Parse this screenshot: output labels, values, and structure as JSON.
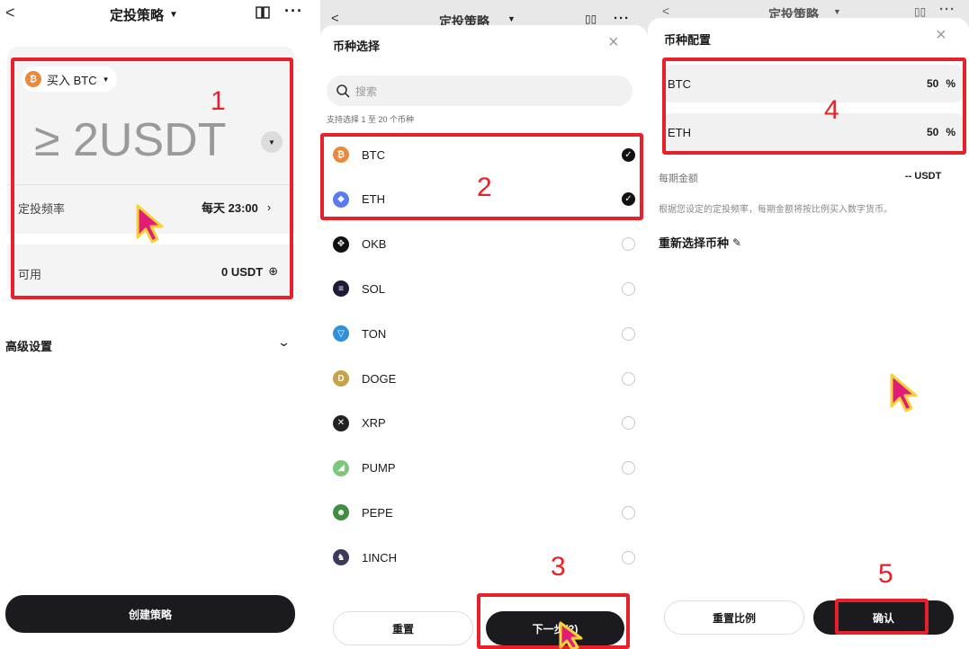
{
  "panel1": {
    "title": "定投策略",
    "buy_label": "买入 BTC",
    "amount": "≥ 2USDT",
    "frequency_label": "定投频率",
    "frequency_value": "每天 23:00",
    "available_label": "可用",
    "available_value": "0 USDT",
    "advanced_label": "高级设置",
    "create_button": "创建策略",
    "annotation": "1"
  },
  "panel2": {
    "title": "定投策略",
    "sheet_title": "币种选择",
    "search_placeholder": "搜索",
    "hint": "支持选择 1 至 20 个币种",
    "coins": [
      {
        "name": "BTC",
        "selected": true,
        "color": "#e8893b",
        "glyph": "₿"
      },
      {
        "name": "ETH",
        "selected": true,
        "color": "#5b7cf0",
        "glyph": "◆"
      },
      {
        "name": "OKB",
        "selected": false,
        "color": "#111111",
        "glyph": "✥"
      },
      {
        "name": "SOL",
        "selected": false,
        "color": "#1e1b3a",
        "glyph": "≡"
      },
      {
        "name": "TON",
        "selected": false,
        "color": "#2f8fd8",
        "glyph": "▽"
      },
      {
        "name": "DOGE",
        "selected": false,
        "color": "#c8a24a",
        "glyph": "D"
      },
      {
        "name": "XRP",
        "selected": false,
        "color": "#222222",
        "glyph": "✕"
      },
      {
        "name": "PUMP",
        "selected": false,
        "color": "#7dc67d",
        "glyph": "◢"
      },
      {
        "name": "PEPE",
        "selected": false,
        "color": "#3f8f3f",
        "glyph": "☻"
      },
      {
        "name": "1INCH",
        "selected": false,
        "color": "#3a3a5a",
        "glyph": "♞"
      }
    ],
    "reset_button": "重置",
    "next_button": "下一步(2)",
    "annotation_2": "2",
    "annotation_3": "3"
  },
  "panel3": {
    "title": "定投策略",
    "sheet_title": "币种配置",
    "allocations": [
      {
        "coin": "BTC",
        "value": "50",
        "unit": "%"
      },
      {
        "coin": "ETH",
        "value": "50",
        "unit": "%"
      }
    ],
    "period_amount_label": "每期金额",
    "period_amount_value": "-- USDT",
    "note": "根据您设定的定投频率，每期金额将按比例买入数字货币。",
    "reselect_label": "重新选择币种",
    "reset_ratio_button": "重置比例",
    "confirm_button": "确认",
    "annotation_4": "4",
    "annotation_5": "5"
  }
}
